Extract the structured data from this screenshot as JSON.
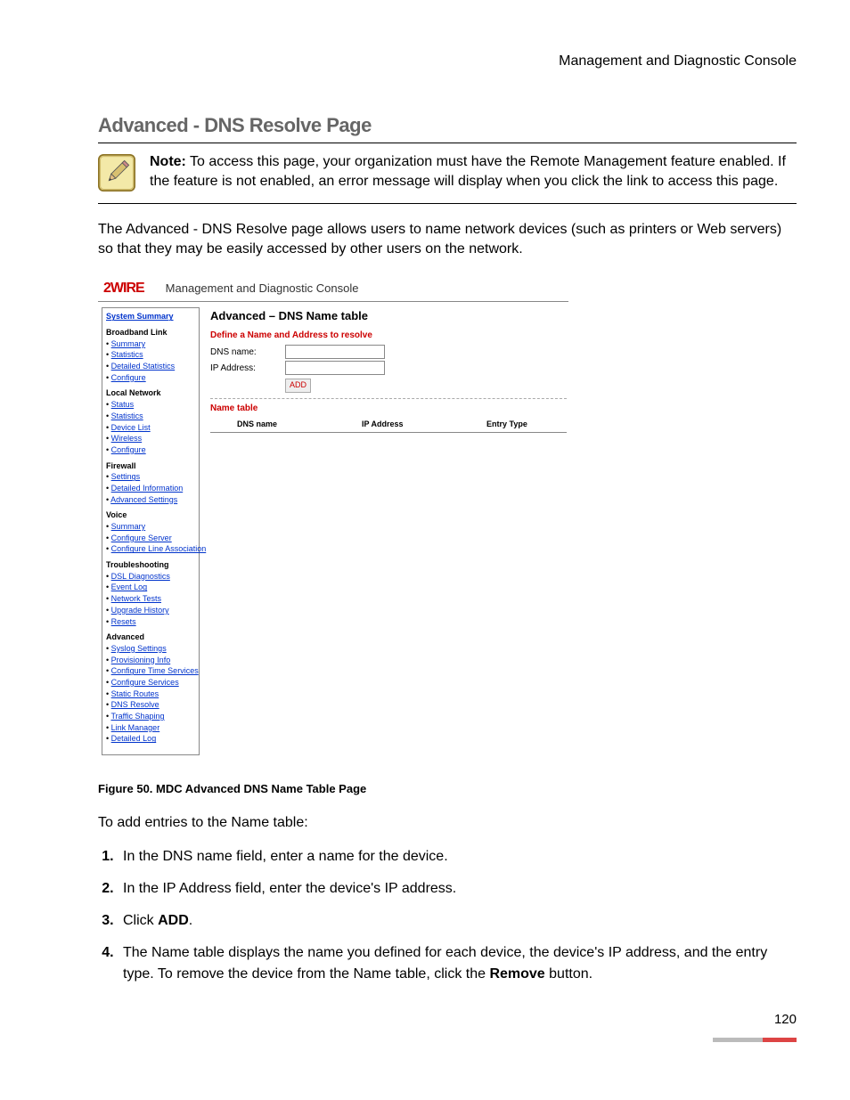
{
  "doc_header": "Management and Diagnostic Console",
  "section_title": "Advanced - DNS Resolve Page",
  "note": {
    "label": "Note:",
    "text": " To access this page, your organization must have the Remote Management feature enabled. If the feature is not enabled, an error message will display when you click the link to access this page."
  },
  "intro": "The Advanced - DNS Resolve page allows users to name network devices (such as printers or Web servers) so that they may be easily accessed by other users on the network.",
  "console": {
    "logo": "2WIRE",
    "title": "Management and Diagnostic Console",
    "sidebar": {
      "top": "System Summary",
      "groups": [
        {
          "title": "Broadband Link",
          "items": [
            "Summary",
            "Statistics",
            "Detailed Statistics",
            "Configure"
          ]
        },
        {
          "title": "Local Network",
          "items": [
            "Status",
            "Statistics",
            "Device List",
            "Wireless",
            "Configure"
          ]
        },
        {
          "title": "Firewall",
          "items": [
            "Settings",
            "Detailed Information",
            "Advanced Settings"
          ]
        },
        {
          "title": "Voice",
          "items": [
            "Summary",
            "Configure Server",
            "Configure Line Association"
          ]
        },
        {
          "title": "Troubleshooting",
          "items": [
            "DSL Diagnostics",
            "Event Log",
            "Network Tests",
            "Upgrade History",
            "Resets"
          ]
        },
        {
          "title": "Advanced",
          "items": [
            "Syslog Settings",
            "Provisioning Info",
            "Configure Time Services",
            "Configure Services",
            "Static Routes",
            "DNS Resolve",
            "Traffic Shaping",
            "Link Manager",
            "Detailed Log"
          ]
        }
      ]
    },
    "panel": {
      "heading": "Advanced – DNS Name table",
      "form_title": "Define a Name and Address to resolve",
      "dns_label": "DNS name:",
      "ip_label": "IP Address:",
      "add_label": "ADD",
      "table_title": "Name table",
      "cols": {
        "c1": "DNS name",
        "c2": "IP Address",
        "c3": "Entry Type"
      }
    }
  },
  "figure_caption": "Figure 50. MDC Advanced DNS Name Table Page",
  "steps_intro": "To add entries to the Name table:",
  "steps": [
    "In the DNS name field, enter a name for the device.",
    "In the IP Address field, enter the device's IP address.",
    {
      "pre": "Click ",
      "bold": "ADD",
      "post": "."
    },
    {
      "pre": "The Name table displays the name you defined for each device, the device's IP address, and the entry type. To remove the device from the Name table, click the ",
      "bold": "Remove",
      "post": " button."
    }
  ],
  "page_number": "120"
}
